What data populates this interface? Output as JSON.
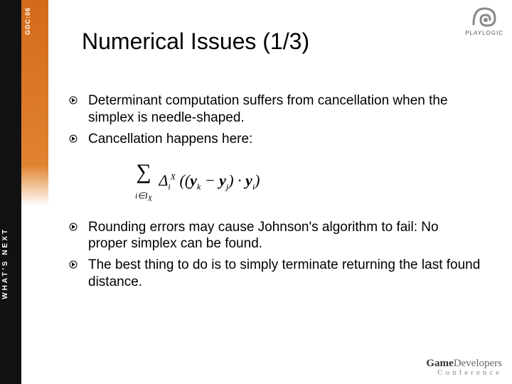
{
  "sidebar": {
    "black_text": "WHAT'S NEXT",
    "orange_text": "GDC:06"
  },
  "title": "Numerical Issues (1/3)",
  "bullets": {
    "b1": "Determinant computation suffers from cancellation when the simplex is needle-shaped.",
    "b2": "Cancellation happens here:",
    "b3": "Rounding errors may cause Johnson's algorithm to fail: No proper simplex can be found.",
    "b4": "The best thing to do is to simply terminate returning the last found distance."
  },
  "logos": {
    "playlogic": "PLAYLOGIC",
    "gdc_game": "Game",
    "gdc_dev": "Developers",
    "gdc_conf": "Conference"
  }
}
